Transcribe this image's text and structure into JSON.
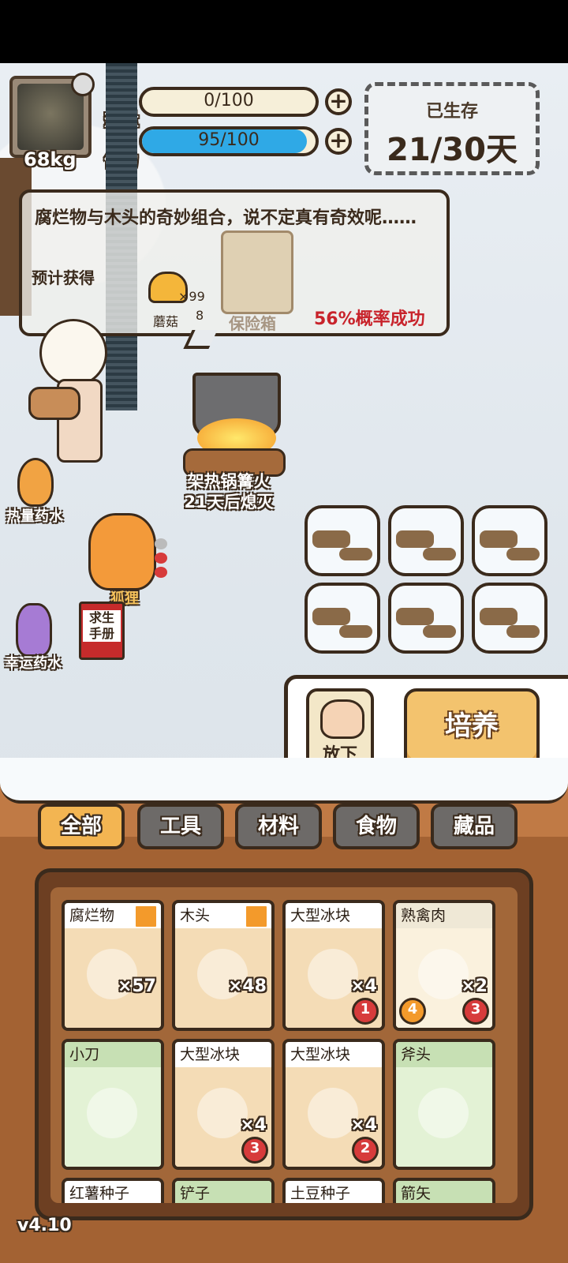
{
  "hud": {
    "weight": "68kg",
    "heat_label": "热量",
    "heat_value": "0/100",
    "heat_fraction": 0.0,
    "stamina_label": "体力",
    "stamina_value": "95/100",
    "stamina_fraction": 0.95,
    "plus_glyph": "+",
    "days_label": "已生存",
    "days_value": "21/30天"
  },
  "dialog": {
    "message": "腐烂物与木头的奇妙组合，说不定真有奇效呢……",
    "expect_label": "预计获得",
    "mushroom_label": "蘑菇",
    "mushroom_qty": "×99",
    "mushroom_qty2": "8",
    "chest_label": "保险箱",
    "success_rate": "56%概率成功"
  },
  "scene": {
    "campfire_name": "架热锅篝火",
    "campfire_timer": "21天后熄灭",
    "heat_potion": "热量药水",
    "fox_label": "狐狸",
    "manual_label": "求生\n手册",
    "luck_potion": "幸运药水"
  },
  "actions": {
    "put_down": "放下",
    "cultivate": "培养"
  },
  "tabs": [
    "全部",
    "工具",
    "材料",
    "食物",
    "藏品"
  ],
  "inventory": [
    {
      "name": "腐烂物",
      "qty": "×57",
      "type": "mat",
      "upgrade": true,
      "badge": ""
    },
    {
      "name": "木头",
      "qty": "×48",
      "type": "mat",
      "upgrade": true,
      "badge": ""
    },
    {
      "name": "大型冰块",
      "qty": "×4",
      "type": "mat",
      "upgrade": false,
      "badge": "1"
    },
    {
      "name": "熟禽肉",
      "qty": "×2",
      "type": "food",
      "upgrade": false,
      "badge": "3",
      "left_badge": "4"
    },
    {
      "name": "小刀",
      "qty": "",
      "type": "tool",
      "upgrade": false,
      "badge": ""
    },
    {
      "name": "大型冰块",
      "qty": "×4",
      "type": "mat",
      "upgrade": false,
      "badge": "3"
    },
    {
      "name": "大型冰块",
      "qty": "×4",
      "type": "mat",
      "upgrade": false,
      "badge": "2"
    },
    {
      "name": "斧头",
      "qty": "",
      "type": "tool",
      "upgrade": false,
      "badge": ""
    },
    {
      "name": "红薯种子",
      "qty": "",
      "type": "mat",
      "upgrade": false,
      "badge": ""
    },
    {
      "name": "铲子",
      "qty": "",
      "type": "tool",
      "upgrade": false,
      "badge": ""
    },
    {
      "name": "土豆种子",
      "qty": "",
      "type": "mat",
      "upgrade": false,
      "badge": ""
    },
    {
      "name": "箭矢",
      "qty": "",
      "type": "tool",
      "upgrade": false,
      "badge": ""
    }
  ],
  "version": "v4.10",
  "colors": {
    "stamina_bar": "#2fa9e6",
    "active_tab": "#f3b552",
    "success_text": "#c8232b"
  }
}
